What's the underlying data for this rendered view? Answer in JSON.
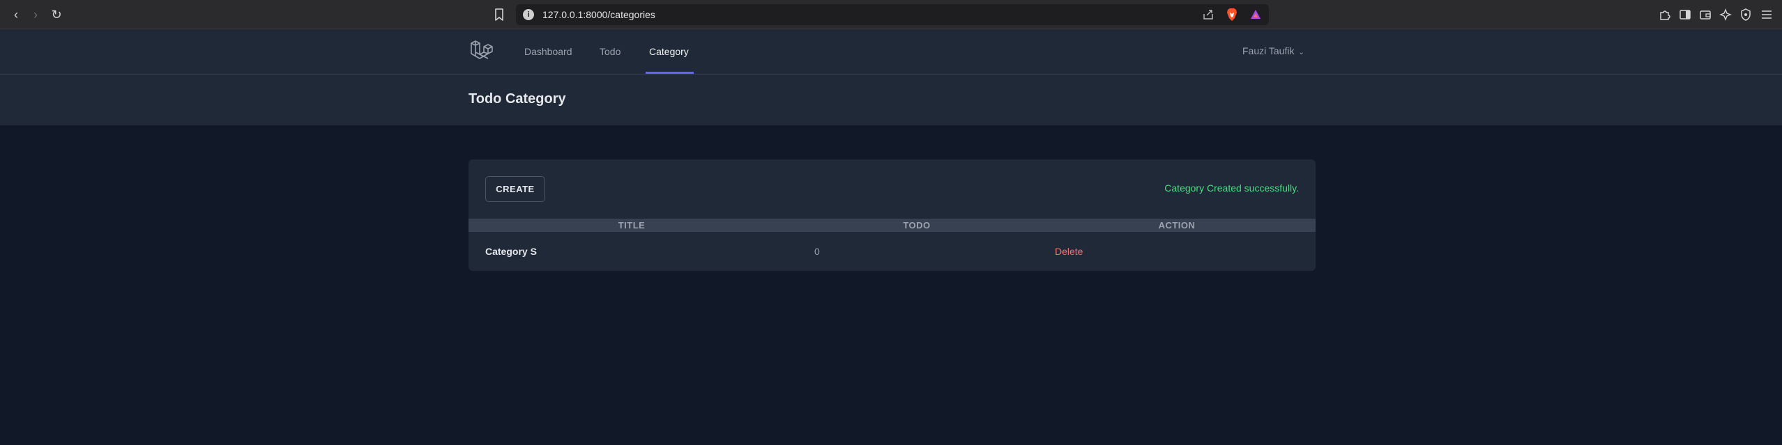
{
  "browser": {
    "url": "127.0.0.1:8000/categories",
    "info_glyph": "i",
    "back_glyph": "‹",
    "forward_glyph": "›",
    "reload_glyph": "↻"
  },
  "nav": {
    "links": [
      {
        "label": "Dashboard"
      },
      {
        "label": "Todo"
      },
      {
        "label": "Category"
      }
    ],
    "user_name": "Fauzi Taufik",
    "user_chevron": "⌄"
  },
  "header": {
    "title": "Todo Category"
  },
  "card": {
    "create_label": "CREATE",
    "flash_message": "Category Created successfully.",
    "columns": [
      "TITLE",
      "TODO",
      "ACTION"
    ],
    "rows": [
      {
        "title": "Category S",
        "todo": "0",
        "action": "Delete"
      }
    ]
  },
  "colors": {
    "accent": "#6366f1",
    "success": "#4ade80",
    "danger": "#f87171",
    "background": "#111827",
    "surface": "#1f2937"
  }
}
